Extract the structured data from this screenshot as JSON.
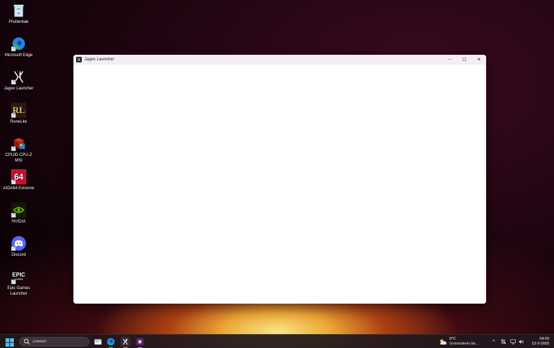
{
  "desktop": {
    "icons": [
      {
        "label": "Prullenbak",
        "icon": "recycle-bin-icon"
      },
      {
        "label": "Microsoft Edge",
        "icon": "edge-icon"
      },
      {
        "label": "Jagex Launcher",
        "icon": "jagex-icon"
      },
      {
        "label": "RuneLite",
        "icon": "runelite-icon"
      },
      {
        "label": "CPUID CPU-Z MSI",
        "icon": "cpuz-icon"
      },
      {
        "label": "AIDA64 Extreme",
        "icon": "aida64-icon"
      },
      {
        "label": "NVIDIA",
        "icon": "nvidia-icon"
      },
      {
        "label": "Discord",
        "icon": "discord-icon"
      },
      {
        "label": "Epic Games Launcher",
        "icon": "epic-games-icon"
      }
    ],
    "shortcut_arrow": "↗",
    "aida_logo_text": "64",
    "rl_text": "RL",
    "epic_text": "EPIC",
    "epic_sub": "GAMES"
  },
  "window": {
    "title": "Jagex Launcher",
    "minimize_glyph": "─",
    "maximize_glyph": "☐",
    "close_glyph": "✕"
  },
  "taskbar": {
    "search_placeholder": "Zoeken",
    "apps": [
      "file-explorer-icon",
      "edge-icon",
      "jagex-icon",
      "runelite-icon"
    ],
    "weather_temp": "0°C",
    "weather_desc": "Grotendeels be...",
    "time": "04:50",
    "date": "12-3-2025",
    "tray_chevron": "^"
  },
  "colors": {
    "accent": "#1a5fc4",
    "edge_blue": "#1e88e5",
    "edge_green": "#42b649",
    "discord": "#5865f2",
    "aida_red": "#c8102e",
    "nvidia_green": "#76b900"
  }
}
